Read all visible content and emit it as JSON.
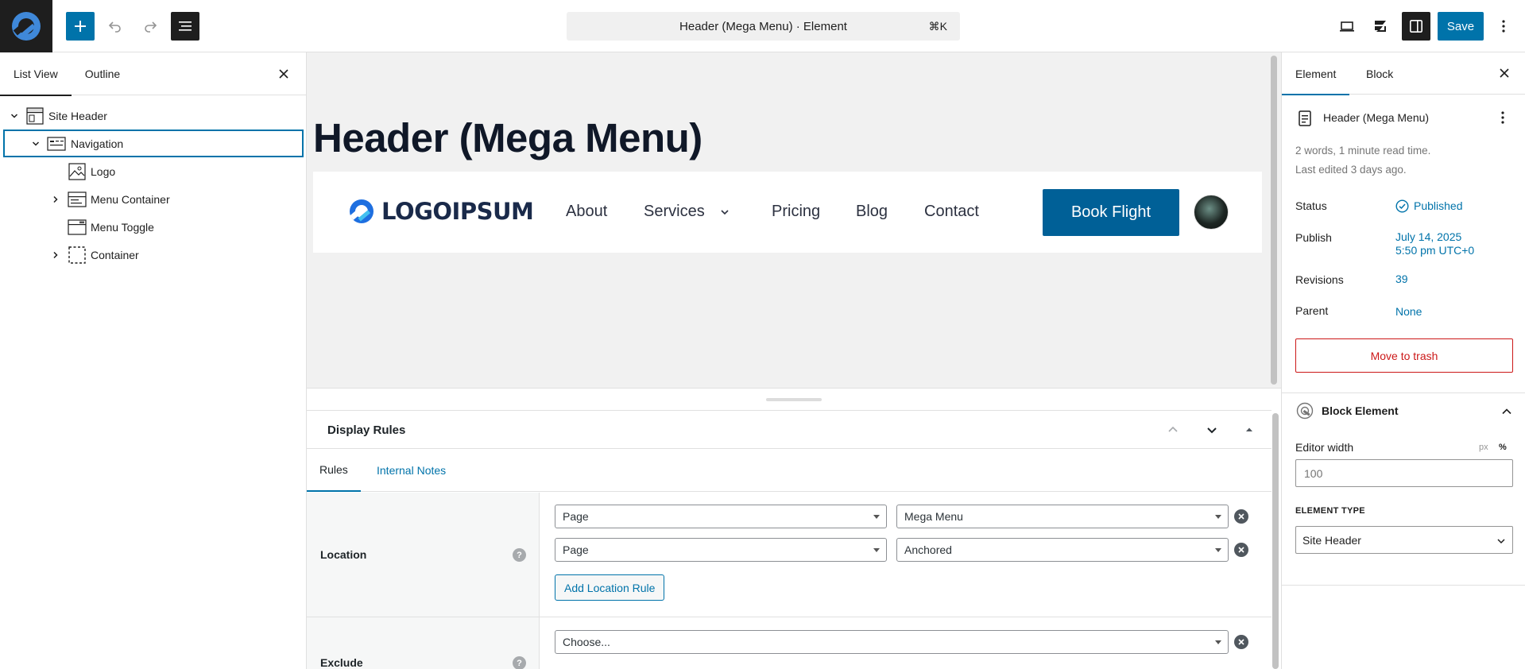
{
  "topbar": {
    "add_icon": "plus-icon",
    "undo_icon": "undo-icon",
    "redo_icon": "redo-icon",
    "list_icon": "list-view-icon",
    "command_title": "Header (Mega Menu) · Element",
    "command_shortcut": "⌘K",
    "save_label": "Save"
  },
  "left_panel": {
    "tabs": [
      {
        "label": "List View",
        "active": true
      },
      {
        "label": "Outline",
        "active": false
      }
    ],
    "tree": [
      {
        "label": "Site Header"
      },
      {
        "label": "Navigation"
      },
      {
        "label": "Logo"
      },
      {
        "label": "Menu Container"
      },
      {
        "label": "Menu Toggle"
      },
      {
        "label": "Container"
      }
    ]
  },
  "canvas": {
    "page_title": "Header (Mega Menu)",
    "logo_text": "LOGOIPSUM",
    "nav": [
      "About",
      "Services",
      "Pricing",
      "Blog",
      "Contact"
    ],
    "cta": "Book Flight"
  },
  "metabox": {
    "title": "Display Rules",
    "tabs": [
      "Rules",
      "Internal Notes"
    ],
    "location": {
      "label": "Location",
      "rules": [
        {
          "type": "Page",
          "value": "Mega Menu"
        },
        {
          "type": "Page",
          "value": "Anchored"
        }
      ],
      "add_label": "Add Location Rule"
    },
    "exclude": {
      "label": "Exclude",
      "placeholder": "Choose..."
    },
    "help": "?"
  },
  "right_panel": {
    "tabs": [
      {
        "label": "Element",
        "active": true
      },
      {
        "label": "Block",
        "active": false
      }
    ],
    "doc_title": "Header (Mega Menu)",
    "meta_line1": "2 words, 1 minute read time.",
    "meta_line2": "Last edited 3 days ago.",
    "status_label": "Status",
    "status_value": "Published",
    "publish_label": "Publish",
    "publish_date": "July 14, 2025",
    "publish_time": "5:50 pm UTC+0",
    "revisions_label": "Revisions",
    "revisions_value": "39",
    "parent_label": "Parent",
    "parent_value": "None",
    "trash_label": "Move to trash",
    "block_element_title": "Block Element",
    "editor_width_label": "Editor width",
    "unit_px": "px",
    "unit_pct": "%",
    "editor_width_placeholder": "100",
    "element_type_label": "ELEMENT TYPE",
    "element_type_value": "Site Header"
  },
  "colors": {
    "accent": "#0073aa",
    "danger": "#cc1818",
    "dark": "#1e1e1e",
    "cta": "#006097"
  }
}
